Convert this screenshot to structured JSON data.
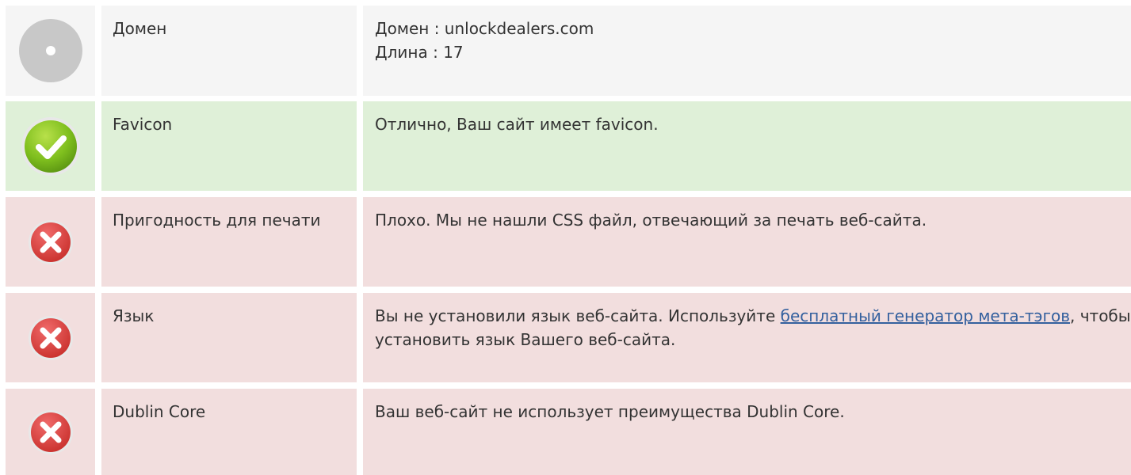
{
  "colors": {
    "neutral_bg": "#f5f5f5",
    "good_bg": "#dff0d8",
    "bad_bg": "#f2dede",
    "link": "#34609e",
    "text": "#333333"
  },
  "rows": [
    {
      "status": "neutral",
      "icon": "neutral-circle-icon",
      "name": "Домен",
      "line1": "Домен : unlockdealers.com",
      "line2": "Длина : 17"
    },
    {
      "status": "good",
      "icon": "check-circle-icon",
      "name": "Favicon",
      "text": "Отлично, Ваш сайт имеет favicon."
    },
    {
      "status": "bad",
      "icon": "error-x-icon",
      "name": "Пригодность для печати",
      "text": "Плохо. Мы не нашли CSS файл, отвечающий за печать веб-сайта."
    },
    {
      "status": "bad",
      "icon": "error-x-icon",
      "name": "Язык",
      "text_before": "Вы не установили язык веб-сайта. Используйте ",
      "link_text": "бесплатный генератор мета-тэгов",
      "text_after": ", чтобы установить язык Вашего веб-сайта."
    },
    {
      "status": "bad",
      "icon": "error-x-icon",
      "name": "Dublin Core",
      "text": "Ваш веб-сайт не использует преимущества Dublin Core."
    }
  ]
}
